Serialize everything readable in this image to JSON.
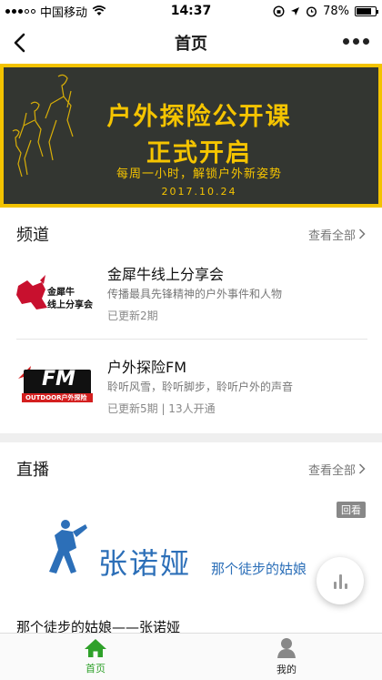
{
  "status_bar": {
    "carrier": "中国移动",
    "time": "14:37",
    "battery": "78%",
    "battery_level": 0.78
  },
  "nav": {
    "title": "首页"
  },
  "banner": {
    "title_line1": "户外探险公开课",
    "title_line2": "正式开启",
    "tagline": "每周一小时，解锁户外新姿势",
    "date": "2017.10.24",
    "accent_color": "#f5c400"
  },
  "channels_section": {
    "title": "频道",
    "view_all": "查看全部"
  },
  "channels": [
    {
      "logo_text_1": "金犀牛",
      "logo_text_2": "线上分享会",
      "name": "金犀牛线上分享会",
      "desc": "传播最具先锋精神的户外事件和人物",
      "meta": "已更新2期"
    },
    {
      "logo_text_1": "FM",
      "logo_text_2": "OUTDOOR户外探险",
      "name": "户外探险FM",
      "desc": "聆听风雪，聆听脚步，聆听户外的声音",
      "meta": "已更新5期 | 13人开通"
    }
  ],
  "live_section": {
    "title": "直播",
    "view_all": "查看全部",
    "badge": "回看",
    "banner_name": "张诺娅",
    "banner_tag": "那个徒步的姑娘",
    "item_title": "那个徒步的姑娘——张诺娅"
  },
  "tabbar": {
    "tabs": [
      {
        "label": "首页",
        "icon": "home-icon",
        "active": true
      },
      {
        "label": "我的",
        "icon": "user-icon",
        "active": false
      }
    ],
    "active_color": "#2fa12a"
  }
}
